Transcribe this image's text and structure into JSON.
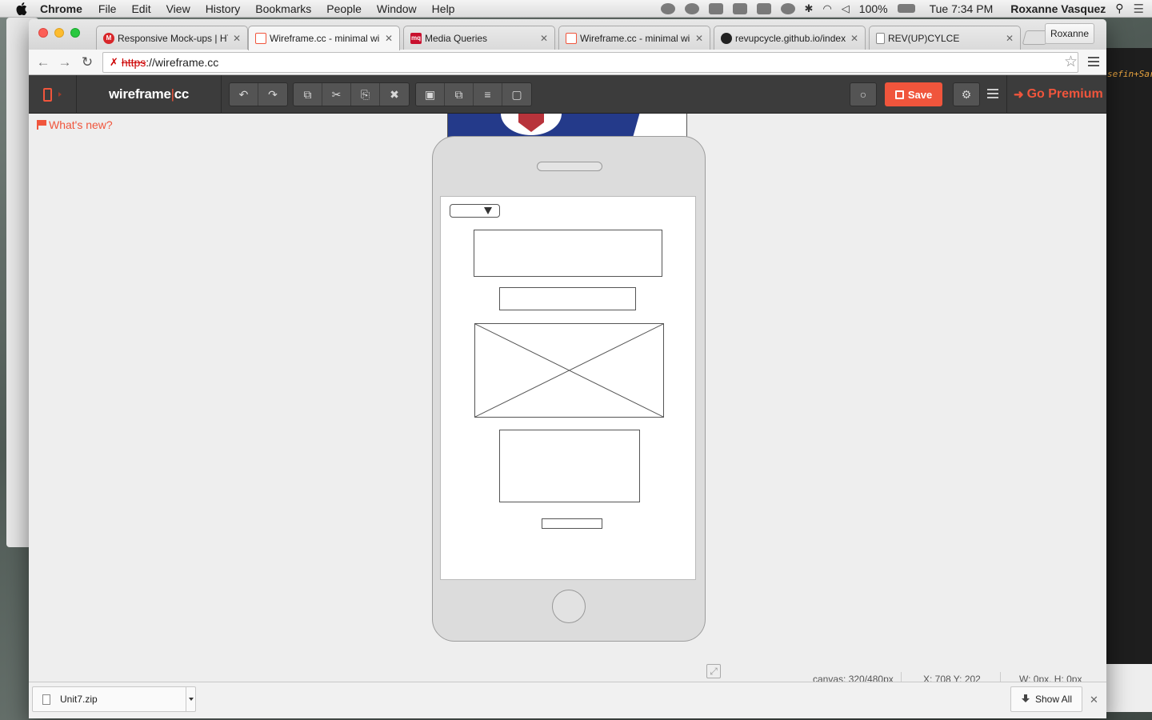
{
  "menubar": {
    "app_name": "Chrome",
    "items": [
      "File",
      "Edit",
      "View",
      "History",
      "Bookmarks",
      "People",
      "Window",
      "Help"
    ],
    "battery": "100%",
    "clock": "Tue 7:34 PM",
    "user": "Roxanne Vasquez"
  },
  "browser": {
    "tabs": [
      {
        "title": "Responsive Mock-ups | HT",
        "favicon": "mockups-favicon",
        "color": "#d8262a"
      },
      {
        "title": "Wireframe.cc - minimal wi",
        "favicon": "wireframe-favicon",
        "color": "#f0553c",
        "active": true
      },
      {
        "title": "Media Queries",
        "favicon": "mq-favicon",
        "color": "#c8102e",
        "badge": "mq"
      },
      {
        "title": "Wireframe.cc - minimal wi",
        "favicon": "wireframe-favicon",
        "color": "#f0553c"
      },
      {
        "title": "revupcycle.github.io/index",
        "favicon": "github-favicon",
        "color": "#222222"
      },
      {
        "title": "REV(UP)CYLCE",
        "favicon": "page-favicon",
        "color": "#888888"
      }
    ],
    "profile": "Roxanne",
    "url_scheme": "https",
    "url_rest": "://wireframe.cc"
  },
  "app": {
    "logo_main": "wireframe",
    "logo_sep": "|",
    "logo_suffix": "cc",
    "save_label": "Save",
    "premium_label": "Go Premium",
    "whats_new": "What's new?",
    "accent": "#f0553c"
  },
  "status": {
    "canvas": "canvas: 320/480px",
    "coords": "X: 708 Y: 202",
    "size": "W: 0px, H: 0px"
  },
  "downloads": {
    "file": "Unit7.zip",
    "show_all": "Show All"
  },
  "background_editor_snippet": "sefin+Sar"
}
